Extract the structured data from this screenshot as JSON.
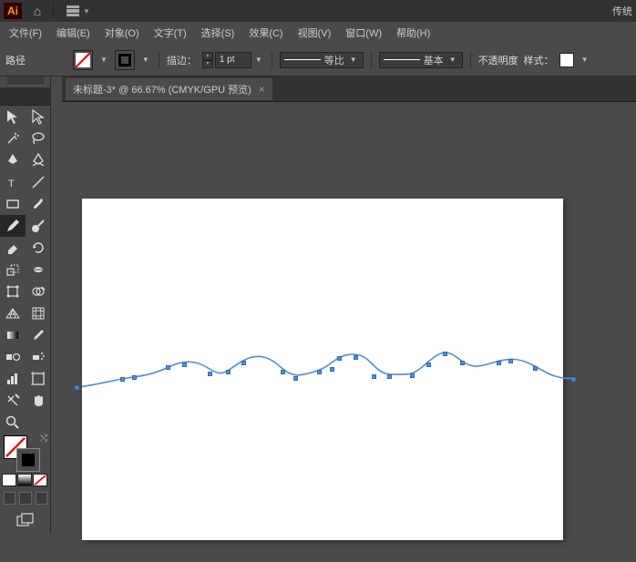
{
  "app": {
    "logo": "Ai",
    "right_label": "传统"
  },
  "menu": {
    "items": [
      "文件(F)",
      "编辑(E)",
      "对象(O)",
      "文字(T)",
      "选择(S)",
      "效果(C)",
      "视图(V)",
      "窗口(W)",
      "帮助(H)"
    ]
  },
  "options": {
    "path_label": "路径",
    "stroke_label": "描边：",
    "stroke_weight": "1 pt",
    "profile_equal": "等比",
    "profile_basic": "基本",
    "opacity_label": "不透明度",
    "style_label": "样式："
  },
  "tab": {
    "title": "未标题-3* @ 66.67% (CMYK/GPU 预览)",
    "close": "×"
  },
  "tools": {
    "title_hint": "toolbox"
  }
}
